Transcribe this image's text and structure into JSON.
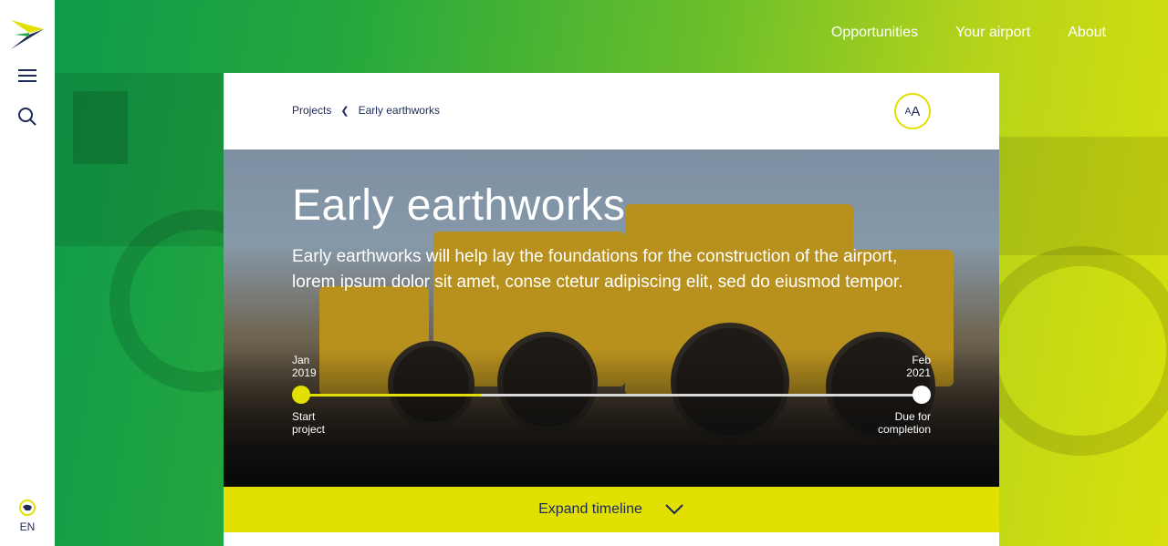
{
  "nav": {
    "items": [
      "Opportunities",
      "Your airport",
      "About"
    ]
  },
  "rail": {
    "language": "EN"
  },
  "breadcrumb": {
    "parent": "Projects",
    "current": "Early earthworks"
  },
  "text_size_button": {
    "small": "A",
    "large": "A"
  },
  "hero": {
    "title": "Early earthworks",
    "description": "Early earthworks will help lay the foundations for the construction of the airport, lorem ipsum dolor sit amet, conse ctetur adipiscing elit, sed do eiusmod tempor."
  },
  "timeline": {
    "start_date": [
      "Jan",
      "2019"
    ],
    "end_date": [
      "Feb",
      "2021"
    ],
    "start_label": [
      "Start",
      "project"
    ],
    "end_label": [
      "Due for",
      "completion"
    ],
    "progress": 0.29
  },
  "expand": {
    "label": "Expand timeline"
  },
  "colors": {
    "accent": "#e2e000",
    "navy": "#1d2a57"
  }
}
